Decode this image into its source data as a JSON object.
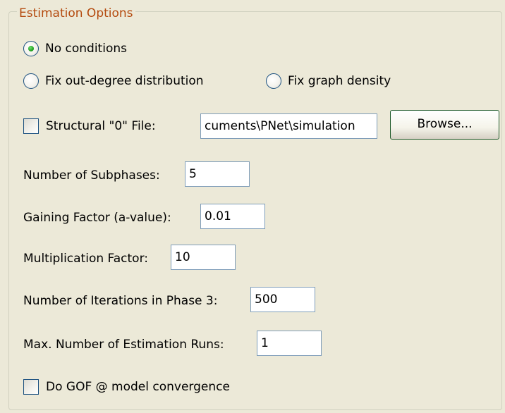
{
  "group": {
    "title": "Estimation Options"
  },
  "conditions": {
    "options": [
      {
        "label": "No conditions",
        "selected": true
      },
      {
        "label": "Fix out-degree distribution",
        "selected": false
      },
      {
        "label": "Fix graph density",
        "selected": false
      }
    ]
  },
  "structural": {
    "checkbox_label": "Structural \"0\" File:",
    "checked": false,
    "file_value": "cuments\\PNet\\simulation",
    "browse_label": "Browse..."
  },
  "fields": {
    "subphases": {
      "label": "Number of Subphases:",
      "value": "5"
    },
    "gaining": {
      "label": "Gaining Factor (a-value):",
      "value": "0.01"
    },
    "multiplication": {
      "label": "Multiplication Factor:",
      "value": "10"
    },
    "iterations": {
      "label": "Number of Iterations in Phase 3:",
      "value": "500"
    },
    "max_runs": {
      "label": "Max. Number of Estimation Runs:",
      "value": "1"
    }
  },
  "gof": {
    "label": "Do GOF @ model convergence",
    "checked": false
  },
  "colors": {
    "legend_text": "#B44A0E",
    "radio_dot": "#21A121",
    "input_border": "#7F9DB9",
    "button_border": "#1F5A2A",
    "background": "#ECE9D8"
  }
}
